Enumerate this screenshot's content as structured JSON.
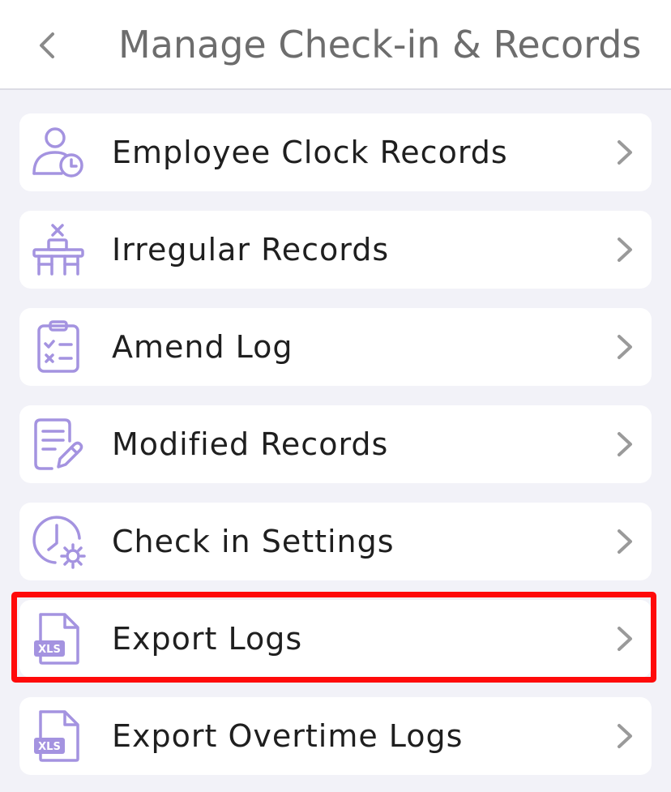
{
  "header": {
    "title": "Manage Check-in & Records"
  },
  "theme": {
    "icon_color": "#a493e0",
    "chevron_color": "#9a9a9a",
    "highlight_color": "#ff0a0a"
  },
  "menu": {
    "items": [
      {
        "label": "Employee Clock Records",
        "icon": "user-clock-icon"
      },
      {
        "label": "Irregular Records",
        "icon": "desk-x-icon"
      },
      {
        "label": "Amend Log",
        "icon": "clipboard-checklist-icon"
      },
      {
        "label": "Modified Records",
        "icon": "document-edit-icon"
      },
      {
        "label": "Check in Settings",
        "icon": "clock-gear-icon"
      },
      {
        "label": "Export Logs",
        "icon": "xls-file-icon",
        "badge": "XLS",
        "highlighted": true
      },
      {
        "label": "Export Overtime Logs",
        "icon": "xls-file-icon",
        "badge": "XLS"
      }
    ]
  }
}
